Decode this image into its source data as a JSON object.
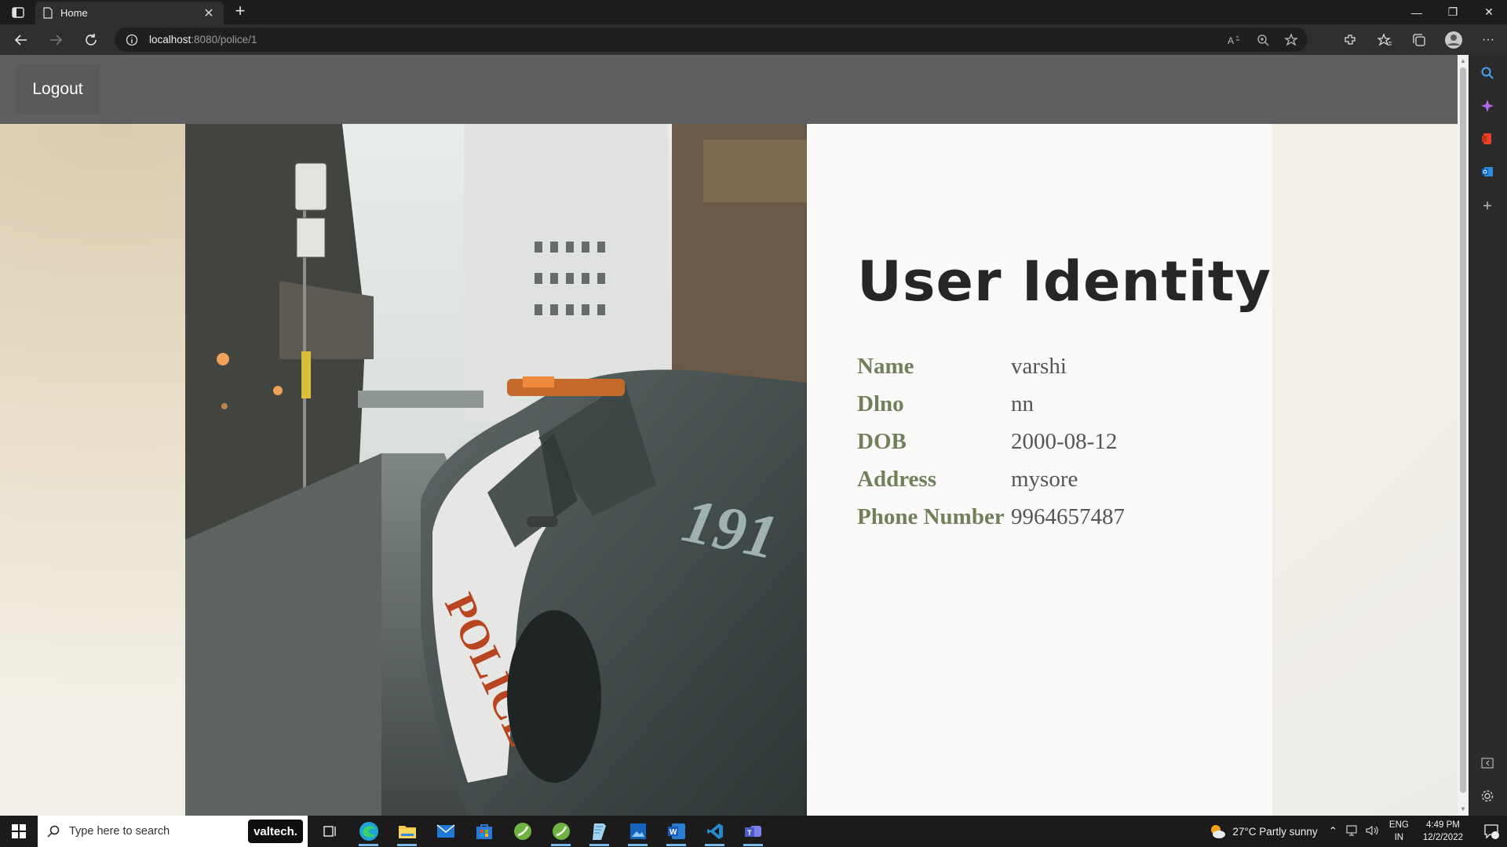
{
  "browser": {
    "tab_title": "Home",
    "url_host": "localhost",
    "url_rest": ":8080/police/1"
  },
  "navbar": {
    "logout_label": "Logout"
  },
  "identity": {
    "title": "User Identity",
    "rows": [
      {
        "label": "Name",
        "value": "varshi"
      },
      {
        "label": "Dlno",
        "value": "nn"
      },
      {
        "label": "DOB",
        "value": "2000-08-12"
      },
      {
        "label": "Address",
        "value": "mysore"
      },
      {
        "label": "Phone Number",
        "value": "9964657487"
      }
    ]
  },
  "photo": {
    "car_text": "POLICE",
    "car_number": "191"
  },
  "taskbar": {
    "search_placeholder": "Type here to search",
    "valtech_label": "valtech.",
    "weather": "27°C  Partly sunny",
    "lang_top": "ENG",
    "lang_bottom": "IN",
    "time": "4:49 PM",
    "date": "12/2/2022",
    "notification_count": "1"
  },
  "icons": {
    "accent": "#76b9ed",
    "label_color": "#71805b",
    "navbar_color": "#5f5f5f"
  }
}
